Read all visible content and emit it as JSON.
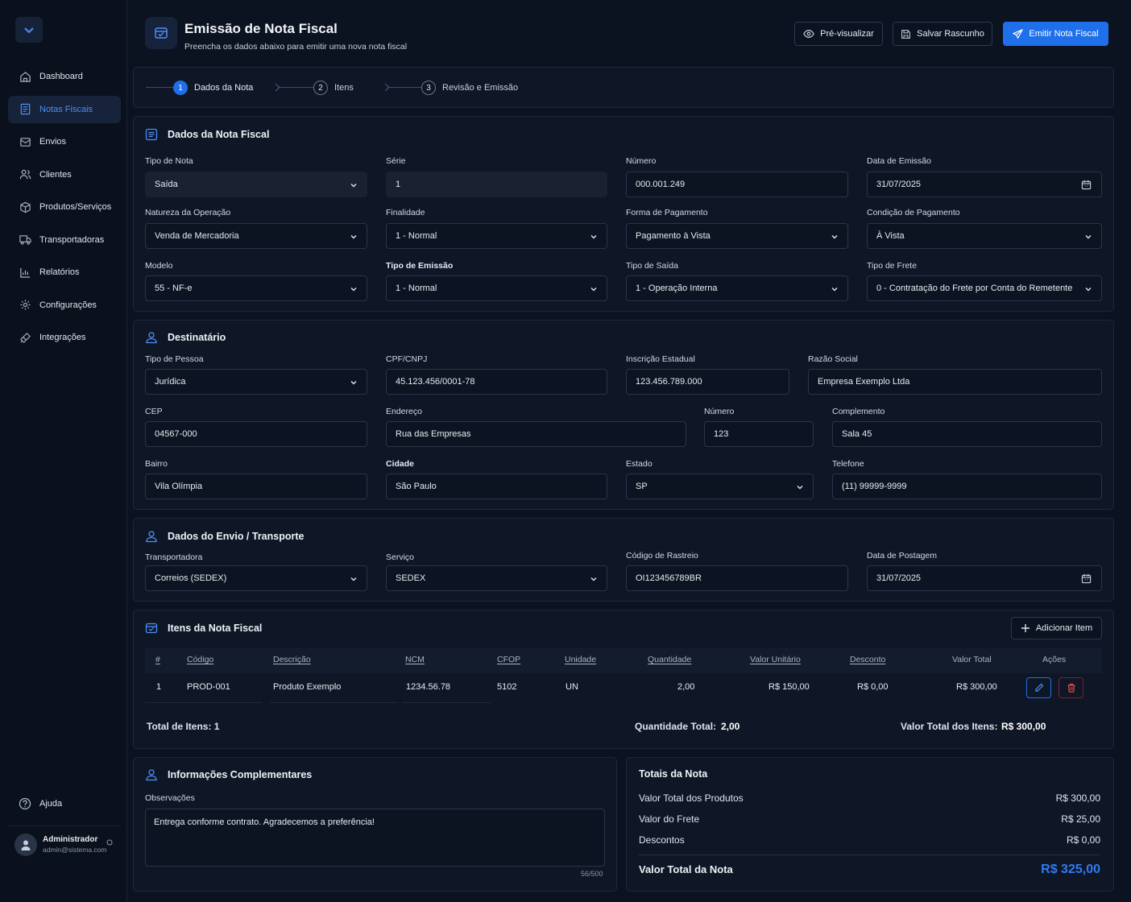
{
  "sidebar": {
    "items": [
      {
        "label": "Dashboard",
        "icon": "home-icon",
        "active": false
      },
      {
        "label": "Notas Fiscais",
        "icon": "document-icon",
        "active": true
      },
      {
        "label": "Envios",
        "icon": "package-icon",
        "active": false
      },
      {
        "label": "Clientes",
        "icon": "users-icon",
        "active": false
      },
      {
        "label": "Produtos/Serviços",
        "icon": "box-icon",
        "active": false
      },
      {
        "label": "Transportadoras",
        "icon": "truck-icon",
        "active": false
      },
      {
        "label": "Relatórios",
        "icon": "chart-icon",
        "active": false
      },
      {
        "label": "Configurações",
        "icon": "gear-icon",
        "active": false
      },
      {
        "label": "Integrações",
        "icon": "plug-icon",
        "active": false
      }
    ],
    "help_label": "Ajuda",
    "user": {
      "name": "Administrador",
      "email": "admin@sistema.com"
    }
  },
  "header": {
    "title": "Emissão de Nota Fiscal",
    "subtitle": "Preencha os dados abaixo para emitir uma nova nota fiscal",
    "preview_label": "Pré-visualizar",
    "draft_label": "Salvar Rascunho",
    "emit_label": "Emitir Nota Fiscal"
  },
  "steps": [
    {
      "num": "1",
      "label": "Dados da Nota",
      "active": true
    },
    {
      "num": "2",
      "label": "Itens",
      "active": false
    },
    {
      "num": "3",
      "label": "Revisão e Emissão",
      "active": false
    }
  ],
  "dados": {
    "title": "Dados da Nota Fiscal",
    "tipo_nota": {
      "label": "Tipo de Nota",
      "value": "Saída"
    },
    "serie": {
      "label": "Série",
      "value": "1"
    },
    "numero": {
      "label": "Número",
      "value": "000.001.249"
    },
    "data_emissao": {
      "label": "Data de Emissão",
      "value": "31/07/2025"
    },
    "natureza": {
      "label": "Natureza da Operação",
      "value": "Venda de Mercadoria"
    },
    "finalidade": {
      "label": "Finalidade",
      "value": "1 - Normal"
    },
    "forma_pagamento": {
      "label": "Forma de Pagamento",
      "value": "Pagamento à Vista"
    },
    "condicao_pagamento": {
      "label": "Condição de Pagamento",
      "value": "À Vista"
    },
    "modelo": {
      "label": "Modelo",
      "value": "55 - NF-e"
    },
    "tipo_emissao": {
      "label": "Tipo de Emissão",
      "value": "1 - Normal"
    },
    "tipo_saida": {
      "label": "Tipo de Saída",
      "value": "1 - Operação Interna"
    },
    "tipo_frete": {
      "label": "Tipo de Frete",
      "value": "0 - Contratação do Frete por Conta do Remetente"
    }
  },
  "destinatario": {
    "title": "Destinatário",
    "tipo_pessoa": {
      "label": "Tipo de Pessoa",
      "value": "Jurídica"
    },
    "cpf_cnpj": {
      "label": "CPF/CNPJ",
      "value": "45.123.456/0001-78"
    },
    "inscricao": {
      "label": "Inscrição Estadual",
      "value": "123.456.789.000"
    },
    "razao": {
      "label": "Razão Social",
      "value": "Empresa Exemplo Ltda"
    },
    "cep": {
      "label": "CEP",
      "value": "04567-000"
    },
    "endereco": {
      "label": "Endereço",
      "value": "Rua das Empresas"
    },
    "numero": {
      "label": "Número",
      "value": "123"
    },
    "complemento": {
      "label": "Complemento",
      "value": "Sala 45"
    },
    "bairro": {
      "label": "Bairro",
      "value": "Vila Olímpia"
    },
    "cidade": {
      "label": "Cidade",
      "value": "São Paulo"
    },
    "estado": {
      "label": "Estado",
      "value": "SP"
    },
    "telefone": {
      "label": "Telefone",
      "value": "(11) 99999-9999"
    }
  },
  "envio": {
    "title": "Dados do Envio / Transporte",
    "transportadora": {
      "label": "Transportadora",
      "value": "Correios (SEDEX)"
    },
    "servico": {
      "label": "Serviço",
      "value": "SEDEX"
    },
    "rastreio": {
      "label": "Código de Rastreio",
      "value": "OI123456789BR"
    },
    "postagem": {
      "label": "Data de Postagem",
      "value": "31/07/2025"
    }
  },
  "itens": {
    "title": "Itens da Nota Fiscal",
    "add_label": "Adicionar Item",
    "columns": [
      "#",
      "Código",
      "Descrição",
      "NCM",
      "CFOP",
      "Unidade",
      "Quantidade",
      "Valor Unitário",
      "Desconto",
      "Valor Total",
      "Ações"
    ],
    "rows": [
      {
        "n": "1",
        "codigo": "PROD-001",
        "descricao": "Produto Exemplo",
        "ncm": "1234.56.78",
        "cfop": "5102",
        "unidade": "UN",
        "quantidade": "2,00",
        "valor_unitario": "R$ 150,00",
        "desconto": "R$ 0,00",
        "valor_total": "R$ 300,00"
      }
    ],
    "total_itens": "Total de Itens: 1",
    "quantidade_total_label": "Quantidade Total:",
    "quantidade_total": "2,00",
    "valor_total_label": "Valor Total dos Itens:",
    "valor_total": "R$ 300,00"
  },
  "complementares": {
    "title": "Informações Complementares",
    "obs_label": "Observações",
    "obs_value": "Entrega conforme contrato. Agradecemos a preferência!",
    "counter": "56/500"
  },
  "totais": {
    "title": "Totais da Nota",
    "produtos_label": "Valor Total dos Produtos",
    "produtos": "R$ 300,00",
    "frete_label": "Valor do Frete",
    "frete": "R$ 25,00",
    "descontos_label": "Descontos",
    "descontos": "R$ 0,00",
    "total_label": "Valor Total da Nota",
    "total": "R$ 325,00"
  },
  "colors": {
    "accent": "#1f6feb",
    "background": "#0b1220",
    "card": "#0f1726",
    "danger": "#e5484d"
  }
}
